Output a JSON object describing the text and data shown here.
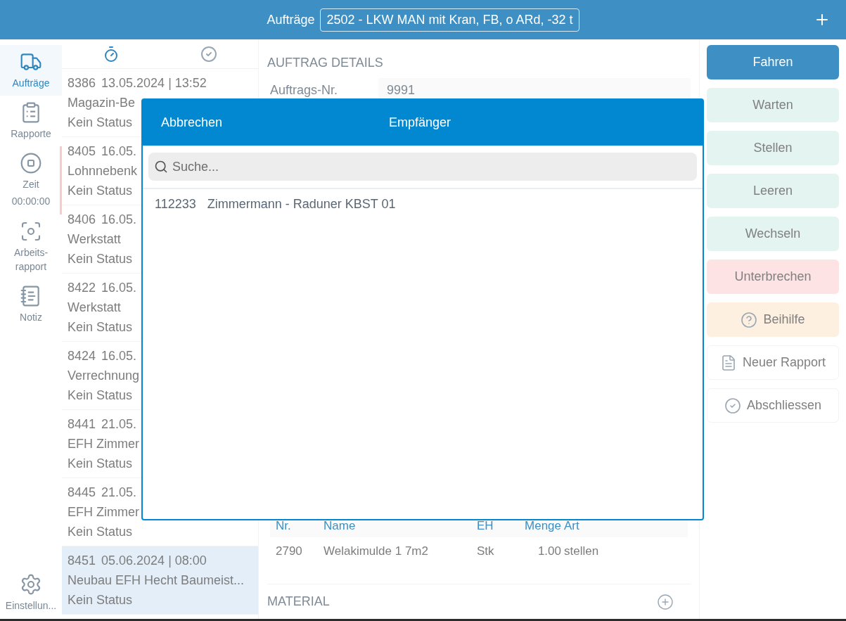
{
  "top_bar": {
    "title": "Aufträge",
    "order": "2502 - LKW MAN mit Kran, FB, o ARd, -32 t"
  },
  "nav": {
    "items": [
      {
        "label": "Aufträge",
        "selected": true
      },
      {
        "label": "Rapporte",
        "selected": false
      },
      {
        "label": "Zeit",
        "selected": false,
        "timer": "00:00:00"
      },
      {
        "label": "Arbeits-\nrapport",
        "selected": false
      },
      {
        "label": "Notiz",
        "selected": false
      }
    ],
    "settings": "Einstellun..."
  },
  "list": {
    "tabs": [
      {
        "selected": true
      },
      {
        "selected": false
      }
    ],
    "rows": [
      {
        "number": "8386",
        "date": "13.05.2024 | 13:52",
        "title": "Magazin-Be",
        "status": "Kein Status",
        "selected": false
      },
      {
        "number": "8405",
        "date": "16.05.",
        "title": "Lohnnebenk",
        "status": "Kein Status",
        "selected": false
      },
      {
        "number": "8406",
        "date": "16.05.",
        "title": "Werkstatt",
        "status": "Kein Status",
        "selected": false
      },
      {
        "number": "8422",
        "date": "16.05.",
        "title": "Werkstatt",
        "status": "Kein Status",
        "selected": false
      },
      {
        "number": "8424",
        "date": "16.05.",
        "title": "Verrechnung",
        "status": "Kein Status",
        "selected": false
      },
      {
        "number": "8441",
        "date": "21.05.",
        "title": "EFH Zimmer",
        "status": "Kein Status",
        "selected": false
      },
      {
        "number": "8445",
        "date": "21.05.",
        "title": "EFH Zimmer",
        "status": "Kein Status",
        "selected": false
      },
      {
        "number": "8451",
        "date": "05.06.2024 | 08:00",
        "title": "Neubau EFH Hecht Baumeist...",
        "status": "Kein Status",
        "selected": true
      }
    ]
  },
  "details": {
    "heading": "AUFTRAG DETAILS",
    "fields": [
      {
        "label": "Auftrags-Nr.",
        "value": "9991"
      }
    ],
    "positions": {
      "columns": [
        "Nr.",
        "Name",
        "EH",
        "Menge",
        "Art"
      ],
      "rows": [
        [
          "2790",
          "Welakimulde 1 7m2",
          "Stk",
          "1.00",
          "stellen"
        ]
      ]
    },
    "material_heading": "MATERIAL"
  },
  "actions": [
    {
      "label": "Fahren",
      "kind": "primary"
    },
    {
      "label": "Warten",
      "kind": "go"
    },
    {
      "label": "Stellen",
      "kind": "go"
    },
    {
      "label": "Leeren",
      "kind": "go"
    },
    {
      "label": "Wechseln",
      "kind": "go"
    },
    {
      "label": "Unterbrechen",
      "kind": "stop"
    },
    {
      "label": "Beihilfe",
      "kind": "help"
    },
    {
      "label": "Neuer Rapport",
      "kind": "report"
    },
    {
      "label": "Abschliessen",
      "kind": "finish"
    }
  ],
  "dialog": {
    "cancel": "Abbrechen",
    "title": "Empfänger",
    "search_placeholder": "Suche...",
    "results": [
      {
        "number": "112233",
        "name": "Zimmermann - Raduner KBST 01"
      }
    ]
  }
}
